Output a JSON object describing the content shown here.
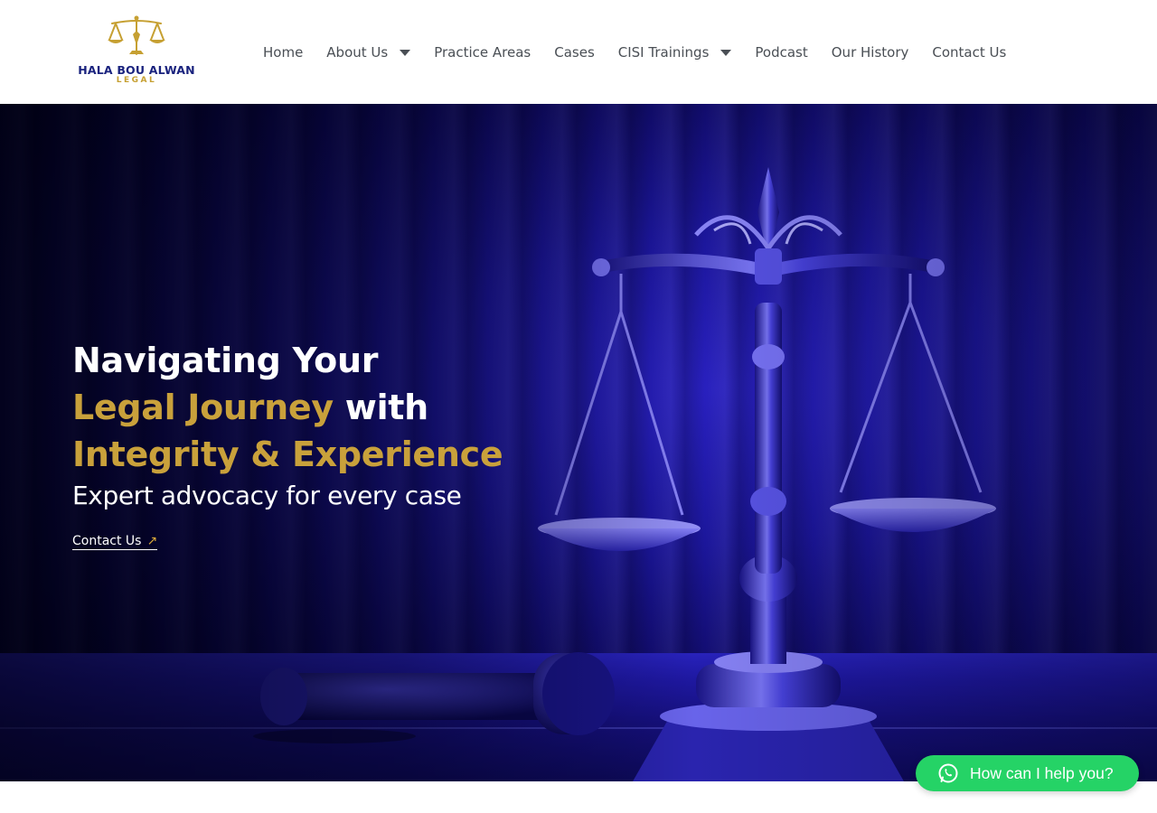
{
  "brand": {
    "name": "HALA BOU ALWAN",
    "sub": "LEGAL",
    "colors": {
      "navy": "#1a237e",
      "gold": "#c6a032"
    }
  },
  "nav": {
    "items": [
      {
        "label": "Home",
        "dropdown": false
      },
      {
        "label": "About Us",
        "dropdown": true
      },
      {
        "label": "Practice Areas",
        "dropdown": false
      },
      {
        "label": "Cases",
        "dropdown": false
      },
      {
        "label": "CISI Trainings",
        "dropdown": true
      },
      {
        "label": "Podcast",
        "dropdown": false
      },
      {
        "label": "Our History",
        "dropdown": false
      },
      {
        "label": "Contact Us",
        "dropdown": false
      }
    ]
  },
  "hero": {
    "headline": {
      "line1": "Navigating Your",
      "line2_gold": "Legal Journey",
      "line2_white": " with",
      "line3_gold": "Integrity & Experience"
    },
    "tagline": "Expert advocacy for every case",
    "cta_label": "Contact Us",
    "cta_icon": "arrow-up-right-icon",
    "background": "scales-of-justice-and-gavel",
    "overlay_color": "#1d17a2"
  },
  "whatsapp": {
    "label": "How can I help you?",
    "icon": "whatsapp-icon",
    "color": "#25d366"
  }
}
